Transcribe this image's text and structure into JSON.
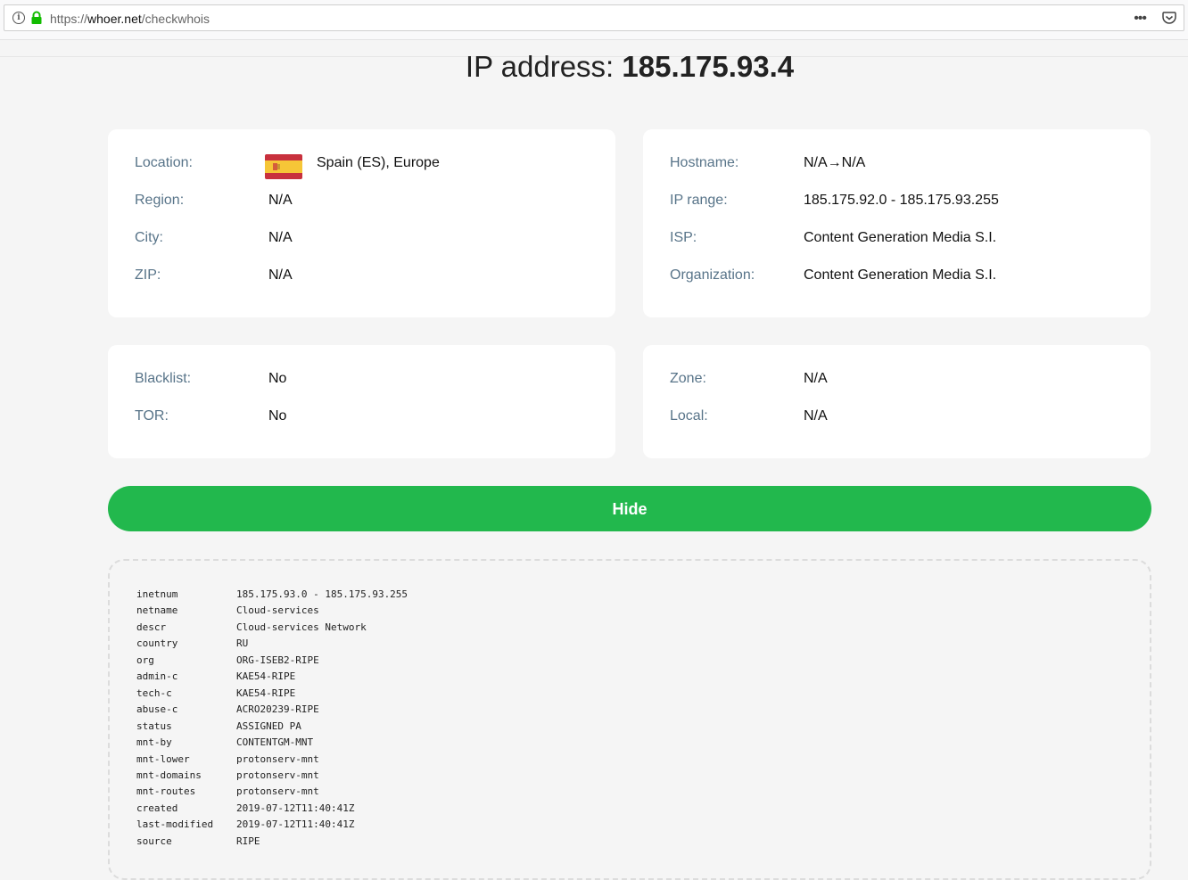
{
  "browser": {
    "url_scheme": "https://",
    "url_host": "whoer.net",
    "url_path": "/checkwhois"
  },
  "title": {
    "prefix": "IP address: ",
    "ip": "185.175.93.4"
  },
  "location_card": {
    "rows": [
      {
        "label": "Location:",
        "value": "Spain (ES), Europe"
      },
      {
        "label": "Region:",
        "value": "N/A"
      },
      {
        "label": "City:",
        "value": "N/A"
      },
      {
        "label": "ZIP:",
        "value": "N/A"
      }
    ],
    "flag_colors": {
      "red": "#c8313d",
      "yellow": "#f6c637"
    }
  },
  "network_card": {
    "rows": [
      {
        "label": "Hostname:",
        "value": "N/A→N/A"
      },
      {
        "label": "IP range:",
        "value": "185.175.92.0 - 185.175.93.255"
      },
      {
        "label": "ISP:",
        "value": "Content Generation Media S.I."
      },
      {
        "label": "Organization:",
        "value": "Content Generation Media S.I."
      }
    ]
  },
  "blacklist_card": {
    "rows": [
      {
        "label": "Blacklist:",
        "value": "No"
      },
      {
        "label": "TOR:",
        "value": "No"
      }
    ]
  },
  "zone_card": {
    "rows": [
      {
        "label": "Zone:",
        "value": "N/A"
      },
      {
        "label": "Local:",
        "value": "N/A"
      }
    ]
  },
  "hide_button": {
    "label": "Hide",
    "color": "#22b84d"
  },
  "whois": [
    {
      "key": "inetnum",
      "value": "185.175.93.0 - 185.175.93.255"
    },
    {
      "key": "netname",
      "value": "Cloud-services"
    },
    {
      "key": "descr",
      "value": "Cloud-services Network"
    },
    {
      "key": "country",
      "value": "RU"
    },
    {
      "key": "org",
      "value": "ORG-ISEB2-RIPE"
    },
    {
      "key": "admin-c",
      "value": "KAE54-RIPE"
    },
    {
      "key": "tech-c",
      "value": "KAE54-RIPE"
    },
    {
      "key": "abuse-c",
      "value": "ACRO20239-RIPE"
    },
    {
      "key": "status",
      "value": "ASSIGNED PA"
    },
    {
      "key": "mnt-by",
      "value": "CONTENTGM-MNT"
    },
    {
      "key": "mnt-lower",
      "value": "protonserv-mnt"
    },
    {
      "key": "mnt-domains",
      "value": "protonserv-mnt"
    },
    {
      "key": "mnt-routes",
      "value": "protonserv-mnt"
    },
    {
      "key": "created",
      "value": "2019-07-12T11:40:41Z"
    },
    {
      "key": "last-modified",
      "value": "2019-07-12T11:40:41Z"
    },
    {
      "key": "source",
      "value": "RIPE"
    }
  ]
}
